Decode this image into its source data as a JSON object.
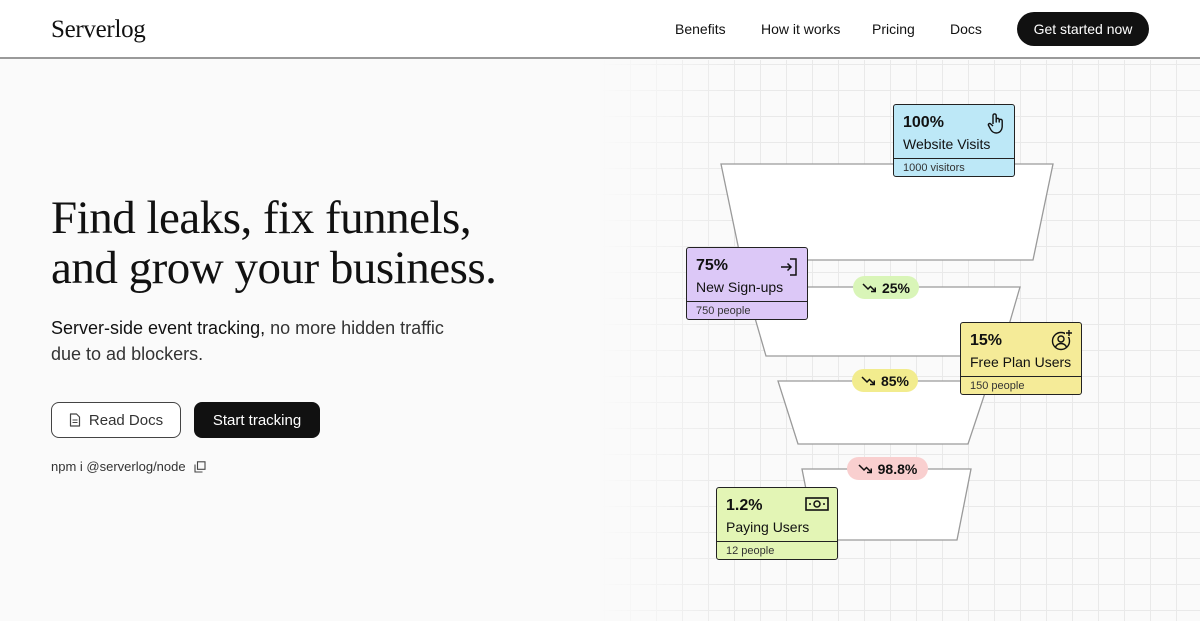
{
  "header": {
    "logo": "Serverlog",
    "nav": [
      "Benefits",
      "How it works",
      "Pricing",
      "Docs"
    ],
    "cta": "Get started now"
  },
  "hero": {
    "headline_line1": "Find leaks, fix funnels,",
    "headline_line2": "and grow your business.",
    "sub_strong": "Server-side event tracking,",
    "sub_rest": " no more hidden traffic due to ad blockers.",
    "btn_docs": "Read Docs",
    "btn_track": "Start tracking",
    "npm": "npm i @serverlog/node"
  },
  "funnel": {
    "cards": [
      {
        "pct": "100%",
        "title": "Website Visits",
        "sub": "1000 visitors",
        "icon": "pointer-hand-icon",
        "color": "#bde8f7"
      },
      {
        "pct": "75%",
        "title": "New Sign-ups",
        "sub": "750 people",
        "icon": "sign-in-icon",
        "color": "#dcc8f7"
      },
      {
        "pct": "15%",
        "title": "Free Plan Users",
        "sub": "150 people",
        "icon": "user-add-icon",
        "color": "#f5eb98"
      },
      {
        "pct": "1.2%",
        "title": "Paying Users",
        "sub": "12 people",
        "icon": "money-icon",
        "color": "#e3f5b5"
      }
    ],
    "drops": [
      {
        "value": "25%",
        "color": "#d9f5b8"
      },
      {
        "value": "85%",
        "color": "#f2ec8e"
      },
      {
        "value": "98.8%",
        "color": "#f9cfcf"
      }
    ]
  }
}
